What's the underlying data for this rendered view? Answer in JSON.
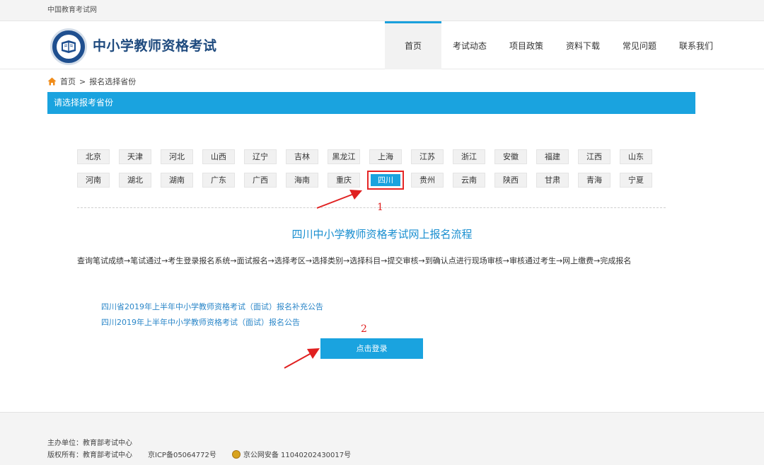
{
  "topbar": {
    "text": "中国教育考试网"
  },
  "header": {
    "site_title": "中小学教师资格考试",
    "nav": [
      "首页",
      "考试动态",
      "项目政策",
      "资料下载",
      "常见问题",
      "联系我们"
    ]
  },
  "breadcrumb": {
    "home": "首页",
    "separator": ">",
    "current": "报名选择省份"
  },
  "section": {
    "title": "请选择报考省份"
  },
  "provinces": {
    "row1": [
      "北京",
      "天津",
      "河北",
      "山西",
      "辽宁",
      "吉林",
      "黑龙江",
      "上海",
      "江苏",
      "浙江",
      "安徽",
      "福建",
      "江西",
      "山东"
    ],
    "row2": [
      "河南",
      "湖北",
      "湖南",
      "广东",
      "广西",
      "海南",
      "重庆",
      "四川",
      "贵州",
      "云南",
      "陕西",
      "甘肃",
      "青海",
      "宁夏"
    ],
    "selected": "四川"
  },
  "flow": {
    "title": "四川中小学教师资格考试网上报名流程",
    "text": "查询笔试成绩→笔试通过→考生登录报名系统→面试报名→选择考区→选择类别→选择科目→提交审核→到确认点进行现场审核→审核通过考生→网上缴费→完成报名"
  },
  "links": [
    "四川省2019年上半年中小学教师资格考试（面试）报名补充公告",
    "四川2019年上半年中小学教师资格考试（面试）报名公告"
  ],
  "login_button": "点击登录",
  "annotations": {
    "one": "1",
    "two": "2"
  },
  "footer": {
    "host": "主办单位：教育部考试中心",
    "copyright": "版权所有：教育部考试中心",
    "icp": "京ICP备05064772号",
    "police": "京公网安备 11040202430017号"
  },
  "colors": {
    "accent": "#1aa3df",
    "brand": "#1e4a7e",
    "annotation": "#e02020"
  },
  "icons": {
    "logo": "book-emblem-icon",
    "home": "home-icon",
    "police": "police-badge-icon",
    "arrow": "red-arrow-icon"
  }
}
